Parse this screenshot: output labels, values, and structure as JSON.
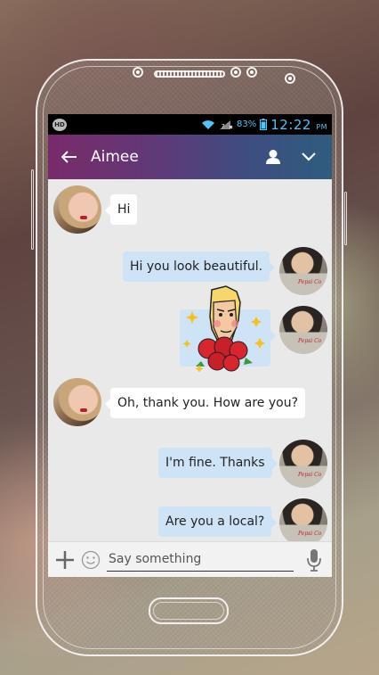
{
  "status_bar": {
    "battery_percent": "83%",
    "time": "12:22",
    "ampm": "PM",
    "icons": [
      "hd-icon",
      "wifi-icon",
      "signal-icon",
      "battery-icon"
    ]
  },
  "header": {
    "title": "Aimee",
    "back_icon": "arrow-left-icon",
    "contact_icon": "person-icon",
    "menu_icon": "chevron-down-icon"
  },
  "messages": [
    {
      "from": "her",
      "text": "Hi"
    },
    {
      "from": "me",
      "text": "Hi you look beautiful."
    },
    {
      "from": "me",
      "type": "sticker",
      "sticker": "rose-bouquet-sticker"
    },
    {
      "from": "her",
      "text": "Oh, thank you. How are you?"
    },
    {
      "from": "me",
      "text": "I'm fine. Thanks"
    },
    {
      "from": "me",
      "text": "Are you a local?"
    }
  ],
  "input": {
    "placeholder": "Say something",
    "value": "",
    "icons": [
      "plus-icon",
      "smiley-icon",
      "microphone-icon"
    ]
  },
  "colors": {
    "header_gradient_start": "#7a2a6a",
    "header_gradient_end": "#2f5c7e",
    "incoming_bubble": "#ffffff",
    "outgoing_bubble": "#cfe3f7",
    "chat_background": "#e9e9e9",
    "status_accent": "#4fc3f7"
  }
}
